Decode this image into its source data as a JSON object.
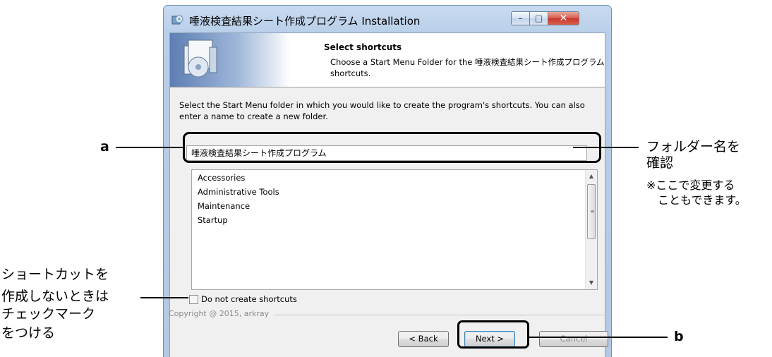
{
  "window": {
    "title": "唾液検査結果シート作成プログラム Installation",
    "minimize_glyph": "–",
    "maximize_glyph": "□",
    "close_glyph": "✕"
  },
  "header": {
    "title": "Select shortcuts",
    "description": "Choose a Start Menu Folder for the 唾液検査結果シート作成プログラム shortcuts.",
    "icon": "installer-box-icon"
  },
  "body_text": "Select the Start Menu folder in which you would like to create the program's shortcuts. You can also enter a name to create a new folder.",
  "folder_input": {
    "value": "唾液検査結果シート作成プログラム"
  },
  "folder_list": {
    "items": [
      "Accessories",
      "Administrative Tools",
      "Maintenance",
      "Startup"
    ],
    "scroll_up": "▲",
    "scroll_down": "▼",
    "grip": "≡"
  },
  "no_shortcuts_checkbox": {
    "label": "Do not create shortcuts",
    "checked": false
  },
  "copyright": "Copyright @ 2015, arkray",
  "buttons": {
    "back": "< Back",
    "next": "Next >",
    "cancel": "Cancel"
  },
  "annotations": {
    "a": "a",
    "b": "b",
    "folder_note_1": "フォルダー名を",
    "folder_note_2": "確認",
    "folder_note_3": "※ここで変更する",
    "folder_note_4": "こともできます。",
    "checkbox_note_1": "ショートカットを",
    "checkbox_note_2": "作成しないときは",
    "checkbox_note_3": "チェックマーク",
    "checkbox_note_4": "をつける"
  },
  "colors": {
    "highlight": "#000000",
    "close_button": "#c7352a",
    "frame": "#b9cfe9"
  }
}
